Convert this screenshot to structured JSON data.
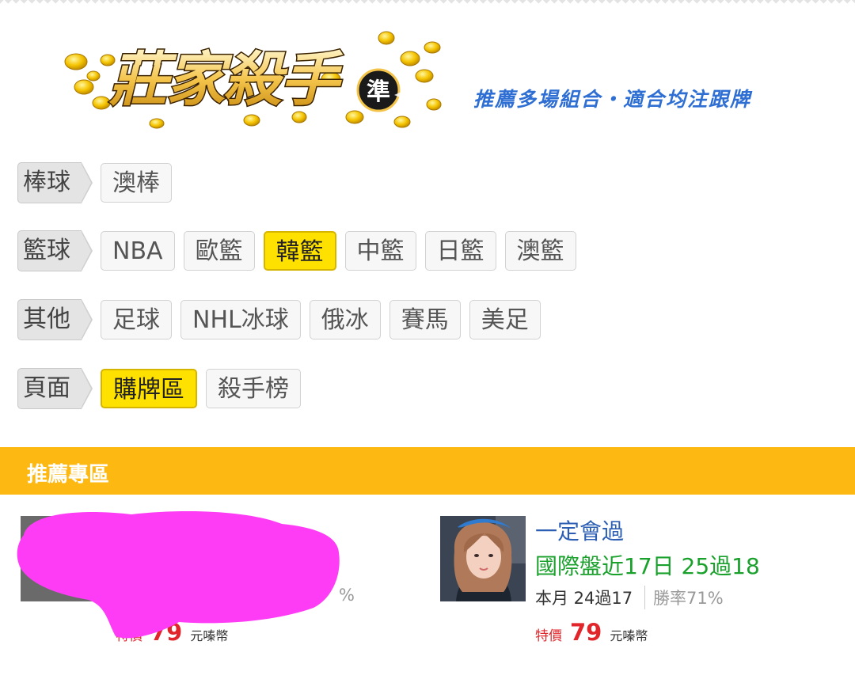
{
  "header": {
    "logo_text": "莊家殺手",
    "logo_badge": "準",
    "slogan": "推薦多場組合・適合均注跟牌"
  },
  "categories": [
    {
      "label": "棒球",
      "tags": [
        {
          "label": "澳棒",
          "active": false
        }
      ]
    },
    {
      "label": "籃球",
      "tags": [
        {
          "label": "NBA",
          "active": false
        },
        {
          "label": "歐籃",
          "active": false
        },
        {
          "label": "韓籃",
          "active": true
        },
        {
          "label": "中籃",
          "active": false
        },
        {
          "label": "日籃",
          "active": false
        },
        {
          "label": "澳籃",
          "active": false
        }
      ]
    },
    {
      "label": "其他",
      "tags": [
        {
          "label": "足球",
          "active": false
        },
        {
          "label": "NHL冰球",
          "active": false
        },
        {
          "label": "俄冰",
          "active": false
        },
        {
          "label": "賽馬",
          "active": false
        },
        {
          "label": "美足",
          "active": false
        }
      ]
    },
    {
      "label": "頁面",
      "tags": [
        {
          "label": "購牌區",
          "active": true
        },
        {
          "label": "殺手榜",
          "active": false
        }
      ]
    }
  ],
  "section": {
    "title": "推薦專區"
  },
  "cards": [
    {
      "name": "",
      "record": "",
      "month": "",
      "winrate": "%",
      "price_label": "特價",
      "price_value": "79",
      "price_unit": "元嗪幣",
      "redacted": true
    },
    {
      "name": "一定會過",
      "record": "國際盤近17日 25過18",
      "month": "本月 24過17",
      "winrate": "勝率71%",
      "price_label": "特價",
      "price_value": "79",
      "price_unit": "元嗪幣",
      "redacted": false
    }
  ],
  "colors": {
    "accent_yellow": "#ffe100",
    "section_bar": "#fdb812",
    "slogan_blue": "#2f6fd3",
    "name_blue": "#2c5fb4",
    "record_green": "#19a12c",
    "price_red": "#e0262b",
    "redaction_magenta": "#ff3cf5"
  }
}
